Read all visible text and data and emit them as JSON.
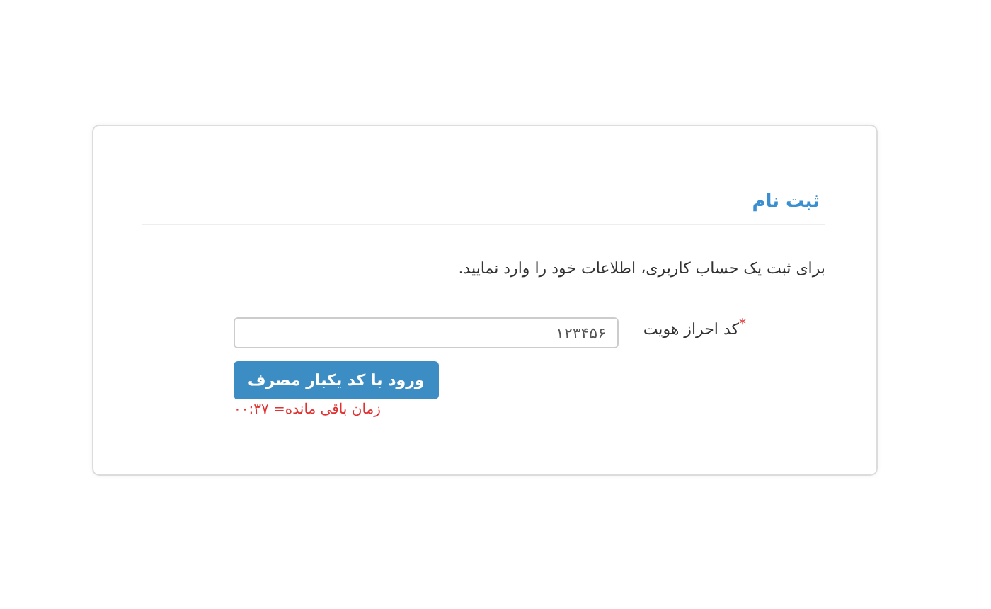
{
  "card": {
    "title": "ثبت نام",
    "description": "برای ثبت یک حساب کاربری، اطلاعات خود را وارد نمایید.",
    "field": {
      "label": "کد احراز هویت",
      "required_mark": "*",
      "value": "۱۲۳۴۵۶"
    },
    "button": "ورود با کد یکبار مصرف",
    "timer": "زمان باقی مانده= ۰۰:۳۷"
  }
}
